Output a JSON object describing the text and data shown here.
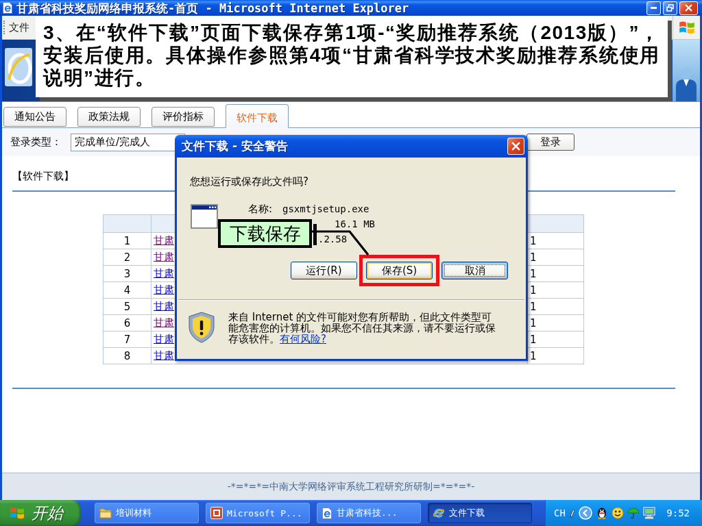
{
  "window": {
    "title": "甘肃省科技奖励网络申报系统-首页 - Microsoft Internet Explorer"
  },
  "menu_bar": {
    "items": [
      "文件"
    ]
  },
  "callout": {
    "text": "3、在“软件下载”页面下载保存第1项-“奖励推荐系统（2013版）”，安装后使用。具体操作参照第4项“甘肃省科学技术奖励推荐系统使用说明”进行。"
  },
  "tabs": [
    {
      "label": "通知公告",
      "selected": false
    },
    {
      "label": "政策法规",
      "selected": false
    },
    {
      "label": "评价指标",
      "selected": false
    },
    {
      "label": "软件下载",
      "selected": true
    }
  ],
  "login": {
    "label": "登录类型：",
    "type": "完成单位/完成人",
    "button": "登录"
  },
  "section": {
    "title": "【软件下载】"
  },
  "table": {
    "rows": [
      {
        "column_1": "1",
        "column_2": "甘肃",
        "visited": true,
        "column_3": "1"
      },
      {
        "column_1": "2",
        "column_2": "甘肃",
        "visited": true,
        "column_3": "1"
      },
      {
        "column_1": "3",
        "column_2": "甘肃",
        "visited": false,
        "column_3": "1"
      },
      {
        "column_1": "4",
        "column_2": "甘肃",
        "visited": false,
        "column_3": "1"
      },
      {
        "column_1": "5",
        "column_2": "甘肃",
        "visited": false,
        "column_3": "1"
      },
      {
        "column_1": "6",
        "column_2": "甘肃",
        "visited": true,
        "column_3": "1"
      },
      {
        "column_1": "7",
        "column_2": "甘肃",
        "visited": false,
        "column_3": "1"
      },
      {
        "column_1": "8",
        "column_2": "甘肃",
        "visited": false,
        "column_3": "1"
      }
    ]
  },
  "dialog": {
    "title": "文件下载 - 安全警告",
    "question": "您想运行或保存此文件吗?",
    "file_info": [
      {
        "label": "名称:",
        "value": "gsxmtjsetup.exe"
      },
      {
        "value": "16.1 MB"
      },
      {
        "value": ".2.58"
      }
    ],
    "annotation": "下载保存",
    "buttons": [
      {
        "label": "运行(R)",
        "default": false,
        "focused": false,
        "highlighted": false
      },
      {
        "label": "保存(S)",
        "default": true,
        "focused": false,
        "highlighted": true
      },
      {
        "label": "取消",
        "default": false,
        "focused": true,
        "highlighted": false
      }
    ],
    "warning": "来自 Internet 的文件可能对您有所帮助，但此文件类型可能危害您的计算机。如果您不信任其来源，请不要运行或保存该软件。",
    "warning_link": "有何风险?"
  },
  "footer": {
    "text": "-*=*=*=中南大学网络评审系统工程研究所研制=*=*=*-"
  },
  "taskbar": {
    "start": "开始",
    "tasks": [
      {
        "kind": "folder",
        "label": "培训材料",
        "selected": false
      },
      {
        "kind": "slides",
        "label": "Microsoft P...",
        "selected": false
      },
      {
        "kind": "page",
        "label": "甘肃省科技...",
        "selected": false
      },
      {
        "kind": "browser",
        "label": "文件下载",
        "selected": true
      }
    ],
    "tray": {
      "language": "CH",
      "clock": "9:52"
    }
  }
}
